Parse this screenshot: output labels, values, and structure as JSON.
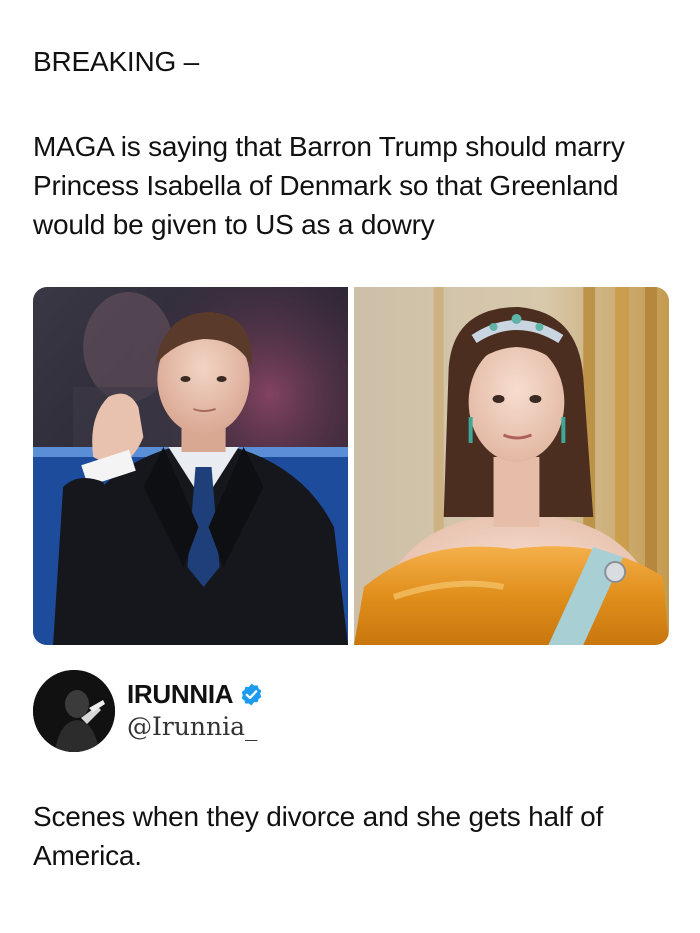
{
  "post": {
    "heading": "BREAKING –",
    "body": "MAGA is saying that Barron Trump should marry Princess Isabella of Denmark so that Greenland would be given to US as a dowry"
  },
  "media": {
    "left_photo_icon": "photo-man-in-suit",
    "right_photo_icon": "photo-woman-in-gown-tiara"
  },
  "reply": {
    "display_name": "IRUNNIA",
    "handle": "@Irunnia_",
    "verified_icon": "verified-badge-icon",
    "verified_color": "#1d9bf0",
    "text": "Scenes when they divorce and she gets half of America."
  }
}
